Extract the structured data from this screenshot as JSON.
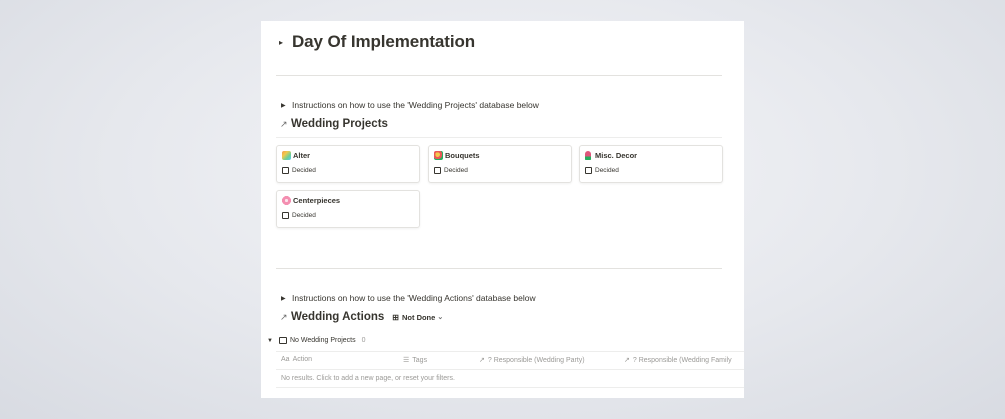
{
  "page": {
    "title": "Day Of Implementation"
  },
  "projects_section": {
    "instructions": "Instructions on how to use the 'Wedding Projects' database below",
    "title": "Wedding Projects",
    "cards": [
      {
        "title": "Alter",
        "icon": "rainbow-icon",
        "icon_color": "#f2994a",
        "property": "Decided"
      },
      {
        "title": "Bouquets",
        "icon": "bouquet-icon",
        "icon_color": "#eb5757",
        "property": "Decided"
      },
      {
        "title": "Misc. Decor",
        "icon": "tulip-icon",
        "icon_color": "#e0557c",
        "property": "Decided"
      },
      {
        "title": "Centerpieces",
        "icon": "flower-icon",
        "icon_color": "#f48fb1",
        "property": "Decided"
      }
    ]
  },
  "actions_section": {
    "instructions": "Instructions on how to use the 'Wedding Actions' database below",
    "title": "Wedding Actions",
    "view": "Not Done",
    "group": {
      "label": "No Wedding Projects",
      "count": "0"
    },
    "columns": [
      {
        "label": "Action",
        "icon": "Aa"
      },
      {
        "label": "Tags",
        "icon": "☰"
      },
      {
        "label": "? Responsible (Wedding Party)",
        "icon": "↗"
      },
      {
        "label": "? Responsible (Wedding Family",
        "icon": "↗"
      }
    ],
    "empty_message": "No results. Click to add a new page, or reset your filters."
  }
}
